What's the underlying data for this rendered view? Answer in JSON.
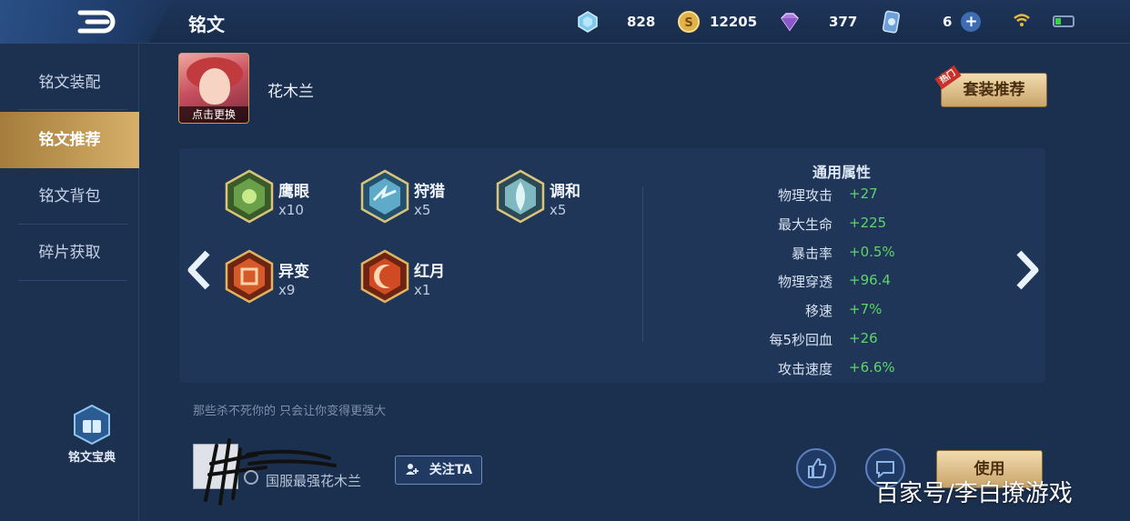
{
  "header": {
    "title": "铭文",
    "resources": [
      {
        "icon": "crystal-icon",
        "value": "828"
      },
      {
        "icon": "gold-coin-icon",
        "value": "12205"
      },
      {
        "icon": "diamond-icon",
        "value": "377"
      },
      {
        "icon": "card-ticket-icon",
        "value": "6"
      }
    ]
  },
  "sidebar": {
    "items": [
      {
        "label": "铭文装配"
      },
      {
        "label": "铭文推荐"
      },
      {
        "label": "铭文背包"
      },
      {
        "label": "碎片获取"
      }
    ],
    "active_index": 1,
    "codex_label": "铭文宝典"
  },
  "hero": {
    "name": "花木兰",
    "change_label": "点击更换"
  },
  "set_recommend": {
    "label": "套装推荐",
    "hot_tag": "热门"
  },
  "runes": [
    {
      "name": "鹰眼",
      "count": "x10",
      "color": "#6aa04a"
    },
    {
      "name": "狩猎",
      "count": "x5",
      "color": "#5fa9c9"
    },
    {
      "name": "调和",
      "count": "x5",
      "color": "#7fb8c0"
    },
    {
      "name": "异变",
      "count": "x9",
      "color": "#d55a2a"
    },
    {
      "name": "红月",
      "count": "x1",
      "color": "#d04a24"
    }
  ],
  "attributes": {
    "title": "通用属性",
    "rows": [
      {
        "label": "物理攻击",
        "value": "+27"
      },
      {
        "label": "最大生命",
        "value": "+225"
      },
      {
        "label": "暴击率",
        "value": "+0.5%"
      },
      {
        "label": "物理穿透",
        "value": "+96.4"
      },
      {
        "label": "移速",
        "value": "+7%"
      },
      {
        "label": "每5秒回血",
        "value": "+26"
      },
      {
        "label": "攻击速度",
        "value": "+6.6%"
      }
    ]
  },
  "author": {
    "motto": "那些杀不死你的 只会让你变得更强大",
    "title": "国服最强花木兰",
    "follow_label": "关注TA"
  },
  "use_label": "使用",
  "watermark": "百家号/李白撩游戏",
  "colors": {
    "accent_gold": "#c9a46a",
    "positive": "#5ed46b",
    "bg": "#1b2f4e"
  }
}
